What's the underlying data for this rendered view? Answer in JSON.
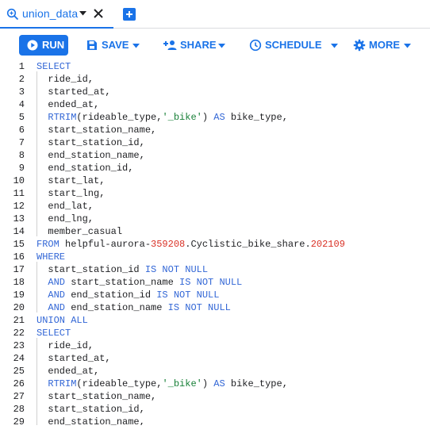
{
  "tab": {
    "title": "union_data",
    "query_icon": "query-icon",
    "caret_icon": "caret-down-icon",
    "close_icon": "close-icon",
    "new_tab_icon": "add-box-icon"
  },
  "toolbar": {
    "run_label": "RUN",
    "save_label": "SAVE",
    "share_label": "SHARE",
    "schedule_label": "SCHEDULE",
    "more_label": "MORE",
    "accent_color": "#1a73e8"
  },
  "editor": {
    "lines": [
      {
        "n": "1",
        "code": [
          [
            "kw",
            "SELECT"
          ]
        ]
      },
      {
        "n": "2",
        "code": [
          [
            "p",
            "  ride_id,"
          ]
        ]
      },
      {
        "n": "3",
        "code": [
          [
            "p",
            "  started_at,"
          ]
        ]
      },
      {
        "n": "4",
        "code": [
          [
            "p",
            "  ended_at,"
          ]
        ]
      },
      {
        "n": "5",
        "code": [
          [
            "p",
            "  "
          ],
          [
            "kw",
            "RTRIM"
          ],
          [
            "p",
            "(rideable_type,"
          ],
          [
            "str",
            "'_bike'"
          ],
          [
            "p",
            ") "
          ],
          [
            "kw",
            "AS"
          ],
          [
            "p",
            " bike_type,"
          ]
        ]
      },
      {
        "n": "6",
        "code": [
          [
            "p",
            "  start_station_name,"
          ]
        ]
      },
      {
        "n": "7",
        "code": [
          [
            "p",
            "  start_station_id,"
          ]
        ]
      },
      {
        "n": "8",
        "code": [
          [
            "p",
            "  end_station_name,"
          ]
        ]
      },
      {
        "n": "9",
        "code": [
          [
            "p",
            "  end_station_id,"
          ]
        ]
      },
      {
        "n": "10",
        "code": [
          [
            "p",
            "  start_lat,"
          ]
        ]
      },
      {
        "n": "11",
        "code": [
          [
            "p",
            "  start_lng,"
          ]
        ]
      },
      {
        "n": "12",
        "code": [
          [
            "p",
            "  end_lat,"
          ]
        ]
      },
      {
        "n": "13",
        "code": [
          [
            "p",
            "  end_lng,"
          ]
        ]
      },
      {
        "n": "14",
        "code": [
          [
            "p",
            "  member_casual"
          ]
        ]
      },
      {
        "n": "15",
        "code": [
          [
            "kw",
            "FROM"
          ],
          [
            "p",
            " helpful-aurora-"
          ],
          [
            "num",
            "359208"
          ],
          [
            "p",
            ".Cyclistic_bike_share."
          ],
          [
            "num",
            "202109"
          ]
        ]
      },
      {
        "n": "16",
        "code": [
          [
            "kw",
            "WHERE"
          ]
        ]
      },
      {
        "n": "17",
        "code": [
          [
            "p",
            "  start_station_id "
          ],
          [
            "kw",
            "IS NOT NULL"
          ]
        ]
      },
      {
        "n": "18",
        "code": [
          [
            "p",
            "  "
          ],
          [
            "kw",
            "AND"
          ],
          [
            "p",
            " start_station_name "
          ],
          [
            "kw",
            "IS NOT NULL"
          ]
        ]
      },
      {
        "n": "19",
        "code": [
          [
            "p",
            "  "
          ],
          [
            "kw",
            "AND"
          ],
          [
            "p",
            " end_station_id "
          ],
          [
            "kw",
            "IS NOT NULL"
          ]
        ]
      },
      {
        "n": "20",
        "code": [
          [
            "p",
            "  "
          ],
          [
            "kw",
            "AND"
          ],
          [
            "p",
            " end_station_name "
          ],
          [
            "kw",
            "IS NOT NULL"
          ]
        ]
      },
      {
        "n": "21",
        "code": [
          [
            "kw",
            "UNION ALL"
          ]
        ]
      },
      {
        "n": "22",
        "code": [
          [
            "kw",
            "SELECT"
          ]
        ]
      },
      {
        "n": "23",
        "code": [
          [
            "p",
            "  ride_id,"
          ]
        ]
      },
      {
        "n": "24",
        "code": [
          [
            "p",
            "  started_at,"
          ]
        ]
      },
      {
        "n": "25",
        "code": [
          [
            "p",
            "  ended_at,"
          ]
        ]
      },
      {
        "n": "26",
        "code": [
          [
            "p",
            "  "
          ],
          [
            "kw",
            "RTRIM"
          ],
          [
            "p",
            "(rideable_type,"
          ],
          [
            "str",
            "'_bike'"
          ],
          [
            "p",
            ") "
          ],
          [
            "kw",
            "AS"
          ],
          [
            "p",
            " bike_type,"
          ]
        ]
      },
      {
        "n": "27",
        "code": [
          [
            "p",
            "  start_station_name,"
          ]
        ]
      },
      {
        "n": "28",
        "code": [
          [
            "p",
            "  start_station_id,"
          ]
        ]
      },
      {
        "n": "29",
        "code": [
          [
            "p",
            "  end_station_name,"
          ]
        ]
      }
    ]
  }
}
